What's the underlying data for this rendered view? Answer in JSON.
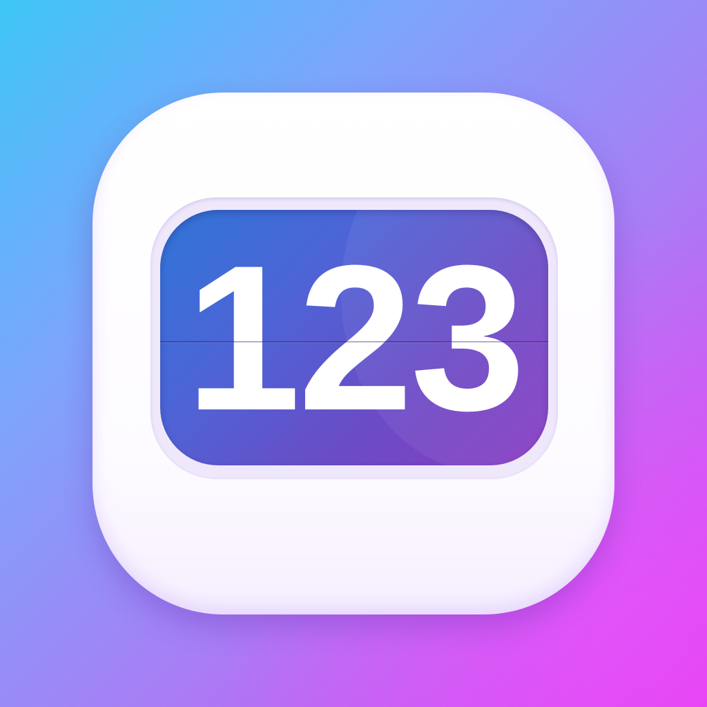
{
  "app_icon": {
    "counter_value": "123",
    "colors": {
      "background_start": "#3ec6f7",
      "background_end": "#e63ff4",
      "tile": "#ffffff",
      "display_start": "#2f75d8",
      "display_end": "#8a3bc4",
      "digits": "#ffffff"
    }
  }
}
